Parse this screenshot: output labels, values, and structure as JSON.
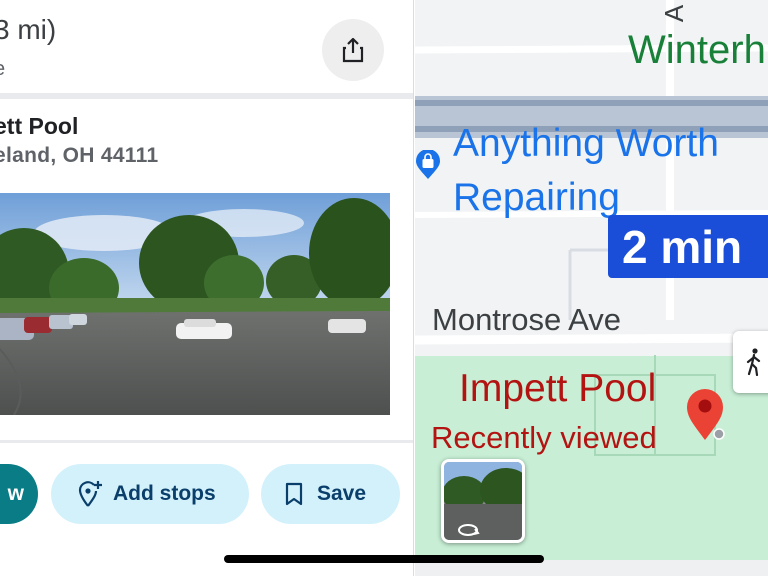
{
  "panel": {
    "distance": "3 mi)",
    "distance_sub": "e",
    "place_name": "ett Pool",
    "place_address": "eland, OH 44111"
  },
  "actions": {
    "go_label": "w",
    "add_stops_label": "Add stops",
    "save_label": "Save"
  },
  "map": {
    "labels": {
      "winterhurst": "Winterh",
      "anything_worth": "Anything Worth",
      "repairing": "Repairing",
      "montrose": "Montrose Ave",
      "impett_pool": "Impett Pool",
      "recently_viewed": "Recently viewed",
      "road_letter": "A"
    },
    "travel_time": "2 min"
  },
  "icons": {
    "share": "share-icon",
    "add_stops": "add-location-icon",
    "save": "bookmark-icon",
    "walk": "walking-person-icon",
    "store": "shopping-bag-pin-icon",
    "place_pin": "red-location-pin-icon",
    "street_view": "rotate-360-icon"
  },
  "colors": {
    "go_button": "#0a7c86",
    "pill_bg": "#d3f1fb",
    "pill_text": "#0b3f6b",
    "travel_badge": "#1a4ed8",
    "park_green": "#c8efd6",
    "place_red": "#b31412",
    "business_blue": "#1a73e8",
    "winter_green": "#188038"
  }
}
